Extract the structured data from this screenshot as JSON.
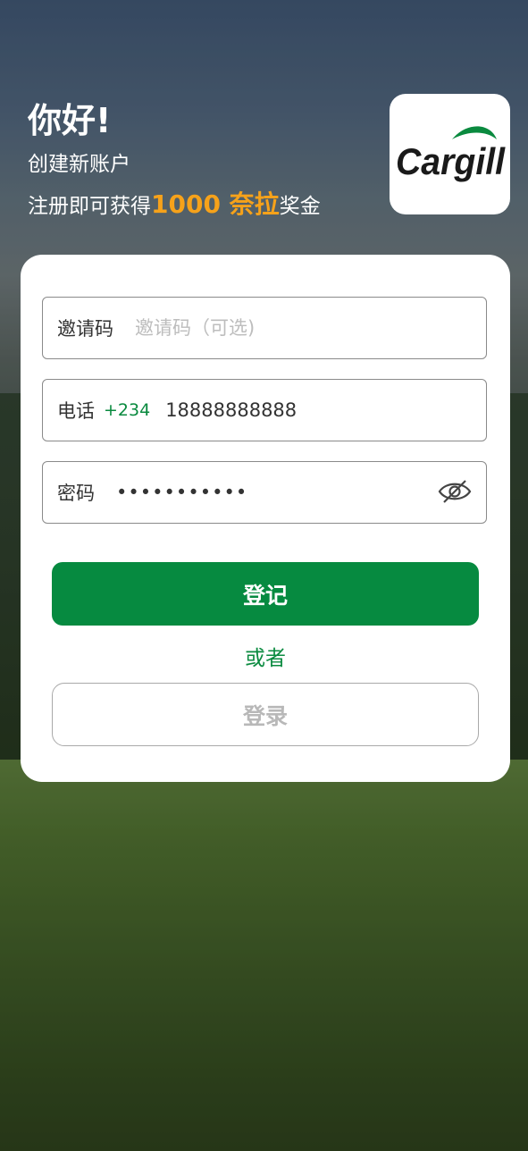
{
  "header": {
    "greeting": "你好!",
    "subtitle": "创建新账户",
    "promo_prefix": "注册即可获得",
    "promo_bonus": "1000 奈拉",
    "promo_suffix": "奖金",
    "bonus_color": "#f6a21a"
  },
  "logo": {
    "text": "Cargill",
    "leaf_color": "#0a8a3f"
  },
  "form": {
    "invite": {
      "label": "邀请码",
      "placeholder": "邀请码（可选)",
      "value": ""
    },
    "phone": {
      "label": "电话",
      "country_code": "+234",
      "value": "18888888888"
    },
    "password": {
      "label": "密码",
      "value": "•••••••••••",
      "toggle_icon": "eye-off-icon"
    }
  },
  "actions": {
    "register_label": "登记",
    "or_label": "或者",
    "login_label": "登录",
    "primary_color": "#068a40"
  }
}
